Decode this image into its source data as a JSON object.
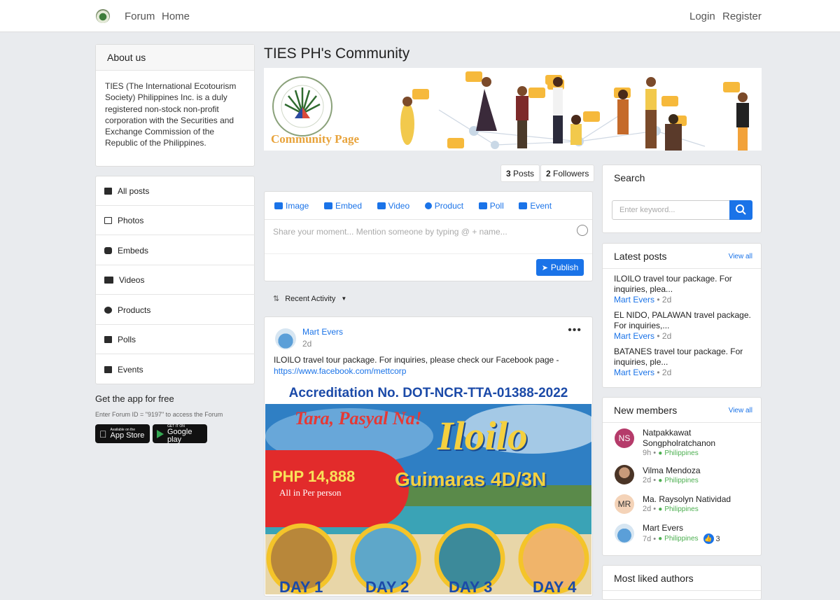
{
  "nav": {
    "forum": "Forum",
    "home": "Home",
    "login": "Login",
    "register": "Register"
  },
  "about": {
    "title": "About us",
    "text": "TIES (The International Ecotourism Society) Philippines Inc. is a duly registered non-stock non-profit corporation with the Securities and Exchange Commission of the Republic of the Philippines."
  },
  "menu": [
    "All posts",
    "Photos",
    "Embeds",
    "Videos",
    "Products",
    "Polls",
    "Events"
  ],
  "app": {
    "title": "Get the app for free",
    "note": "Enter Forum ID = \"9197\" to access the Forum",
    "appstore_small": "Available on the",
    "appstore_big": "App Store",
    "gplay_small": "GET IT ON",
    "gplay_big": "Google play"
  },
  "community": {
    "title": "TIES PH's Community",
    "banner_caption": "Community Page",
    "posts_count": "3",
    "posts_label": "Posts",
    "followers_count": "2",
    "followers_label": "Followers"
  },
  "composer": {
    "tabs": [
      "Image",
      "Embed",
      "Video",
      "Product",
      "Poll",
      "Event"
    ],
    "placeholder": "Share your moment... Mention someone by typing @ + name...",
    "publish": "Publish"
  },
  "sort": {
    "label": "Recent Activity"
  },
  "post": {
    "author": "Mart Evers",
    "time": "2d",
    "text": "ILOILO travel tour package. For inquiries, please check our Facebook page -",
    "link": "https://www.facebook.com/mettcorp",
    "promo": {
      "accreditation": "Accreditation No. DOT-NCR-TTA-01388-2022",
      "tagline": "Tara, Pasyal Na!",
      "destination": "Iloilo",
      "sub": "Guimaras 4D/3N",
      "price": "PHP 14,888",
      "price_note": "All in Per person",
      "days": [
        "DAY 1",
        "DAY 2",
        "DAY 3",
        "DAY 4"
      ]
    }
  },
  "search": {
    "title": "Search",
    "placeholder": "Enter keyword..."
  },
  "latest": {
    "title": "Latest posts",
    "viewall": "View all",
    "items": [
      {
        "title": "ILOILO travel tour package. For inquiries, plea...",
        "author": "Mart Evers",
        "time": "2d"
      },
      {
        "title": "EL NIDO, PALAWAN travel package. For inquiries,...",
        "author": "Mart Evers",
        "time": "2d"
      },
      {
        "title": "BATANES travel tour package. For inquiries, ple...",
        "author": "Mart Evers",
        "time": "2d"
      }
    ]
  },
  "members": {
    "title": "New members",
    "viewall": "View all",
    "items": [
      {
        "initials": "NS",
        "name": "Natpakkawat Songpholratchanon",
        "time": "9h",
        "country": "Philippines",
        "color": "#b53b6a"
      },
      {
        "initials": "",
        "name": "Vilma Mendoza",
        "time": "2d",
        "country": "Philippines",
        "color": "#5a4636"
      },
      {
        "initials": "MR",
        "name": "Ma. Raysolyn Natividad",
        "time": "2d",
        "country": "Philippines",
        "color": "#f4d3b8"
      },
      {
        "initials": "",
        "name": "Mart Evers",
        "time": "7d",
        "country": "Philippines",
        "likes": "3",
        "color": "#7fb3e0"
      }
    ]
  },
  "authors": {
    "title": "Most liked authors"
  }
}
